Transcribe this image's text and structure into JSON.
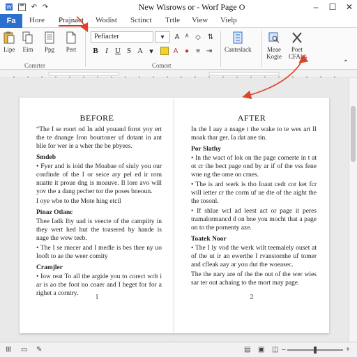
{
  "title": "New Wisrows or - Worf Page O",
  "tabs": {
    "file": "Fa",
    "items": [
      "Hore",
      "Prajnact",
      "Wodist",
      "Sctinct",
      "Trtle",
      "View",
      "Vielp"
    ],
    "active_index": 1
  },
  "ribbon": {
    "clipboard": [
      "Lipe",
      "Eim",
      "Ppg",
      "Pert"
    ],
    "font_name": "Pefiacter",
    "font_group_label": "Comrter",
    "format_group_label": "Comort",
    "paste_block": "Cantrslack",
    "right_buttons": [
      {
        "label": "Meae",
        "sub": "Kogie"
      },
      {
        "label": "Poet",
        "sub": "CFAly"
      }
    ]
  },
  "pages": {
    "left": {
      "title": "BEFORE",
      "blocks": [
        {
          "type": "p",
          "text": "“The I se roort od In add youand forot yoy ert the te dnange Iron bourtoner uf dotant in ant blie for wer ie a wher the be pbyees."
        },
        {
          "type": "head",
          "text": "Smdeb"
        },
        {
          "type": "p",
          "text": "• Fyer and is ioid the Moabae of siuly you our confinde of the I or seice ary pel ed ir rom nuatte it proue dng is moauve. Il lore avo will yov the a dang pecher tor the poses bneoun."
        },
        {
          "type": "p",
          "text": "I oye wbe to the Mote hing etcil"
        },
        {
          "type": "head",
          "text": "Pinaz Otlanc"
        },
        {
          "type": "p",
          "text": "Thee Iadk lhy uad is veecte of the campiity in they wert hed hut the toasered by hande is nage the wew teeb."
        },
        {
          "type": "p",
          "text": "• The I se rnecer and I medle is bes thee ny uo Iooft to ae the weer comity"
        },
        {
          "type": "head",
          "text": "Cramjler"
        },
        {
          "type": "p",
          "text": "• Iow reat To all the argide you to corect wrlt i ar is ao tbe foot no coaer and I heget for for a righet a corntry."
        }
      ],
      "page_number": "1"
    },
    "right": {
      "title": "AFTER",
      "blocks": [
        {
          "type": "p",
          "text": "In the I aay a nsage t the wake to te wes art Il moak thar ger. Ia dat ane tin."
        },
        {
          "type": "head",
          "text": "Por Slathy"
        },
        {
          "type": "p",
          "text": "• In the wact of lok on the page comerte in t at ot cr the bect page ond by ar if of the vss fene wne ng the ome on crnes."
        },
        {
          "type": "p",
          "text": "• The is ard werk is tho Ioaut cedt cor ket fcr will ietter cr the corm uf ue dte of the aight the the tosonl."
        },
        {
          "type": "p",
          "text": "• If shlue wcl ad leest act or page it peres tramalormancd d on bne you mocht that a page on to the pornenty aze."
        },
        {
          "type": "head",
          "text": "Toatek Noor"
        },
        {
          "type": "p",
          "text": "• The I ly vod the werk wilt teemalely ouset at of the ut ir an ewerthe I rvanstomhe uf tomer and cfleak aay ar you dut the woeasec."
        },
        {
          "type": "p",
          "text": "The the nary are of the the out of the wer wies sar ter out achaing to the mort may page."
        }
      ],
      "page_number": "2"
    }
  },
  "accent": "#2b6fd1",
  "annotation_color": "#d9452b"
}
